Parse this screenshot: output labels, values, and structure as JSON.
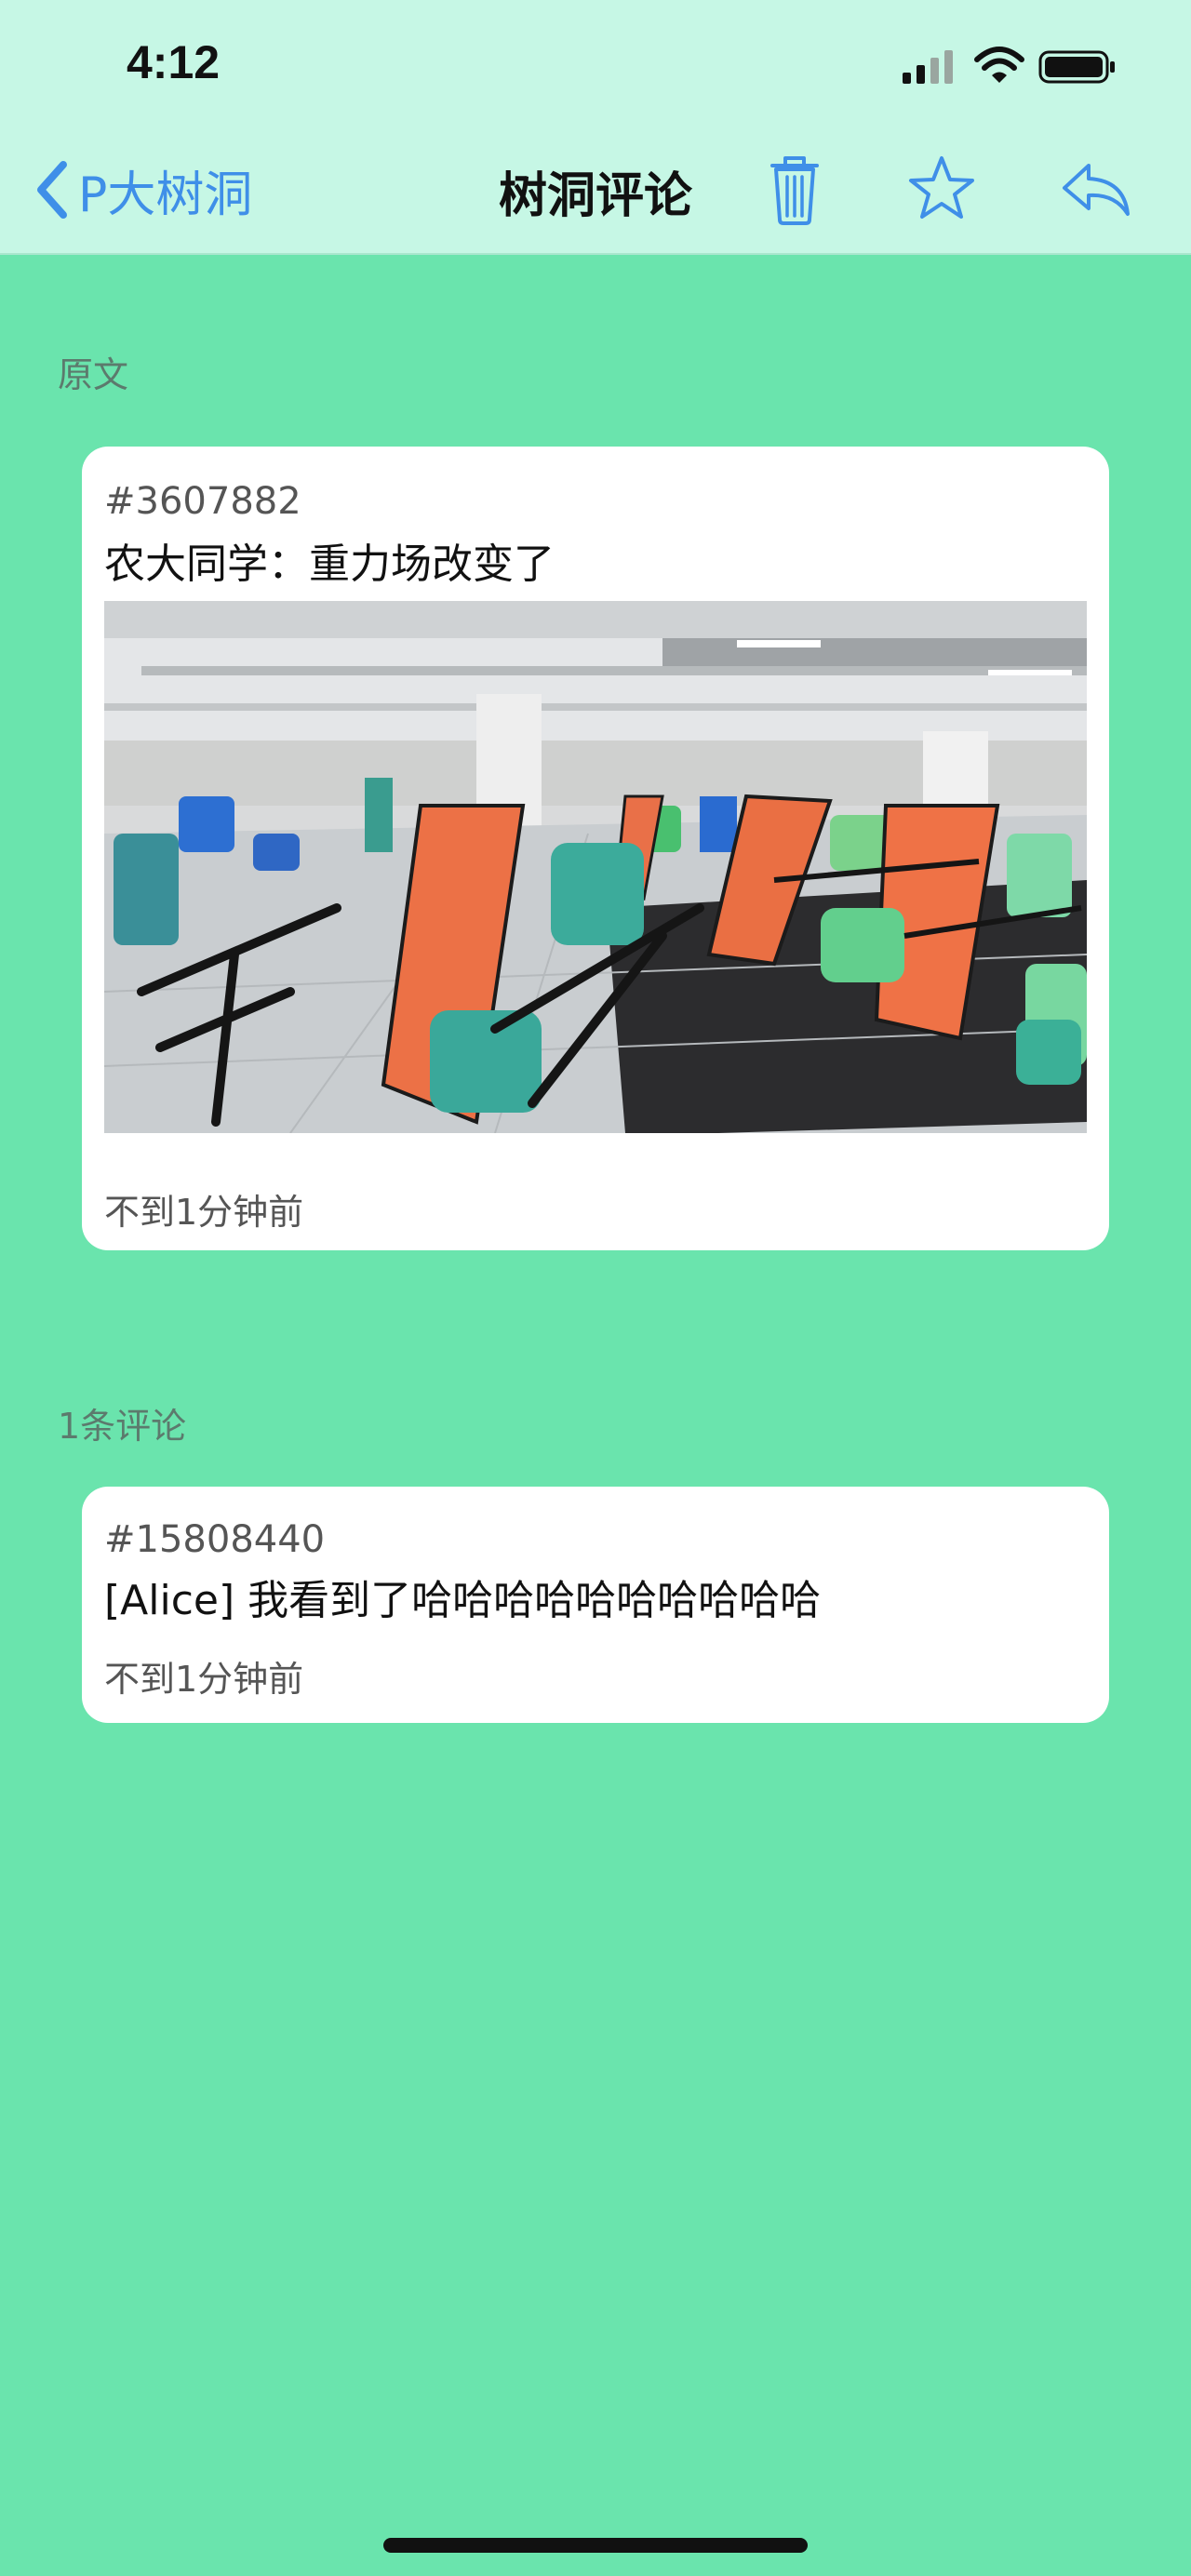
{
  "status_bar": {
    "time": "4:12"
  },
  "nav": {
    "back_label": "P大树洞",
    "title": "树洞评论",
    "icons": [
      "chevron-left-icon",
      "trash-icon",
      "star-icon",
      "reply-icon"
    ],
    "accent_color": "#3f8fe8"
  },
  "original_section": {
    "label": "原文",
    "post": {
      "id": "#3607882",
      "text": "农大同学：重力场改变了",
      "image_description": "photo-of-canteen-with-overturned-tables",
      "time": "不到1分钟前"
    }
  },
  "comments_section": {
    "label": "1条评论",
    "comments": [
      {
        "id": "#15808440",
        "text": "[Alice] 我看到了哈哈哈哈哈哈哈哈哈哈",
        "time": "不到1分钟前"
      }
    ]
  },
  "colors": {
    "background": "#6ae4ad",
    "topbar": "#c6f7e5",
    "card": "#ffffff"
  }
}
